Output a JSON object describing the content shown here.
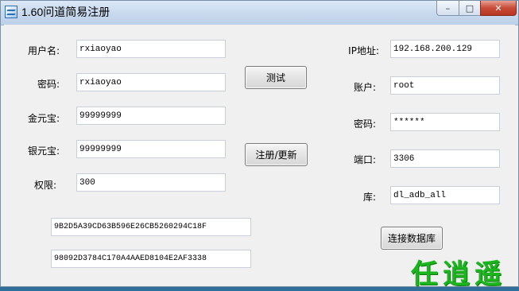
{
  "window": {
    "title": "1.60问道简易注册",
    "minimize_icon": "minimize-icon",
    "maximize_icon": "maximize-icon",
    "close_icon": "close-icon",
    "minimize_glyph": "–",
    "maximize_glyph": "□",
    "close_glyph": "✕"
  },
  "left_form": {
    "username_label": "用户名:",
    "username_value": "rxiaoyao",
    "password_label": "密码:",
    "password_value": "rxiaoyao",
    "gold_label": "金元宝:",
    "gold_value": "99999999",
    "silver_label": "银元宝:",
    "silver_value": "99999999",
    "permission_label": "权限:",
    "permission_value": "300",
    "hash1_value": "9B2D5A39CD63B596E26CB5260294C18F",
    "hash2_value": "98092D3784C170A4AAED8104E2AF3338"
  },
  "buttons": {
    "test_label": "测试",
    "register_label": "注册/更新",
    "connect_label": "连接数据库"
  },
  "right_form": {
    "ip_label": "IP地址:",
    "ip_value": "192.168.200.129",
    "account_label": "账户:",
    "account_value": "root",
    "db_password_label": "密码:",
    "db_password_value": "******",
    "port_label": "端口:",
    "port_value": "3306",
    "database_label": "库:",
    "database_value": "dl_adb_all"
  },
  "logo": {
    "text": "任逍遥",
    "color": "#1bb51e"
  }
}
